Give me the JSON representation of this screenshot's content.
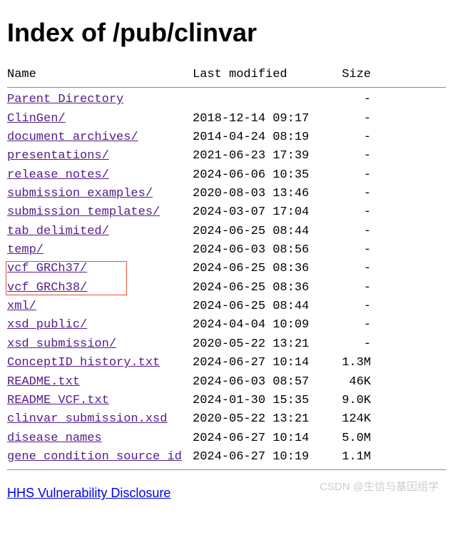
{
  "title": "Index of /pub/clinvar",
  "headers": {
    "name": "Name",
    "modified": "Last modified",
    "size": "Size"
  },
  "entries": [
    {
      "name": "Parent Directory",
      "modified": "",
      "size": "-",
      "visited": true
    },
    {
      "name": "ClinGen/",
      "modified": "2018-12-14 09:17",
      "size": "-",
      "visited": true
    },
    {
      "name": "document_archives/",
      "modified": "2014-04-24 08:19",
      "size": "-",
      "visited": true
    },
    {
      "name": "presentations/",
      "modified": "2021-06-23 17:39",
      "size": "-",
      "visited": true
    },
    {
      "name": "release_notes/",
      "modified": "2024-06-06 10:35",
      "size": "-",
      "visited": true
    },
    {
      "name": "submission_examples/",
      "modified": "2020-08-03 13:46",
      "size": "-",
      "visited": true
    },
    {
      "name": "submission_templates/",
      "modified": "2024-03-07 17:04",
      "size": "-",
      "visited": true
    },
    {
      "name": "tab_delimited/",
      "modified": "2024-06-25 08:44",
      "size": "-",
      "visited": true
    },
    {
      "name": "temp/",
      "modified": "2024-06-03 08:56",
      "size": "-",
      "visited": true
    },
    {
      "name": "vcf_GRCh37/",
      "modified": "2024-06-25 08:36",
      "size": "-",
      "visited": true
    },
    {
      "name": "vcf_GRCh38/",
      "modified": "2024-06-25 08:36",
      "size": "-",
      "visited": true
    },
    {
      "name": "xml/",
      "modified": "2024-06-25 08:44",
      "size": "-",
      "visited": true
    },
    {
      "name": "xsd_public/",
      "modified": "2024-04-04 10:09",
      "size": "-",
      "visited": true
    },
    {
      "name": "xsd_submission/",
      "modified": "2020-05-22 13:21",
      "size": "-",
      "visited": true
    },
    {
      "name": "ConceptID_history.txt",
      "modified": "2024-06-27 10:14",
      "size": "1.3M",
      "visited": true
    },
    {
      "name": "README.txt",
      "modified": "2024-06-03 08:57",
      "size": "46K",
      "visited": true
    },
    {
      "name": "README_VCF.txt",
      "modified": "2024-01-30 15:35",
      "size": "9.0K",
      "visited": true
    },
    {
      "name": "clinvar_submission.xsd",
      "modified": "2020-05-22 13:21",
      "size": "124K",
      "visited": true
    },
    {
      "name": "disease_names",
      "modified": "2024-06-27 10:14",
      "size": "5.0M",
      "visited": true
    },
    {
      "name": "gene_condition_source_id",
      "modified": "2024-06-27 10:19",
      "size": "1.1M",
      "visited": true
    }
  ],
  "footer_link": "HHS Vulnerability Disclosure",
  "watermark": "CSDN @生信与基因组学",
  "highlight": {
    "top_index": 9,
    "count": 2
  }
}
